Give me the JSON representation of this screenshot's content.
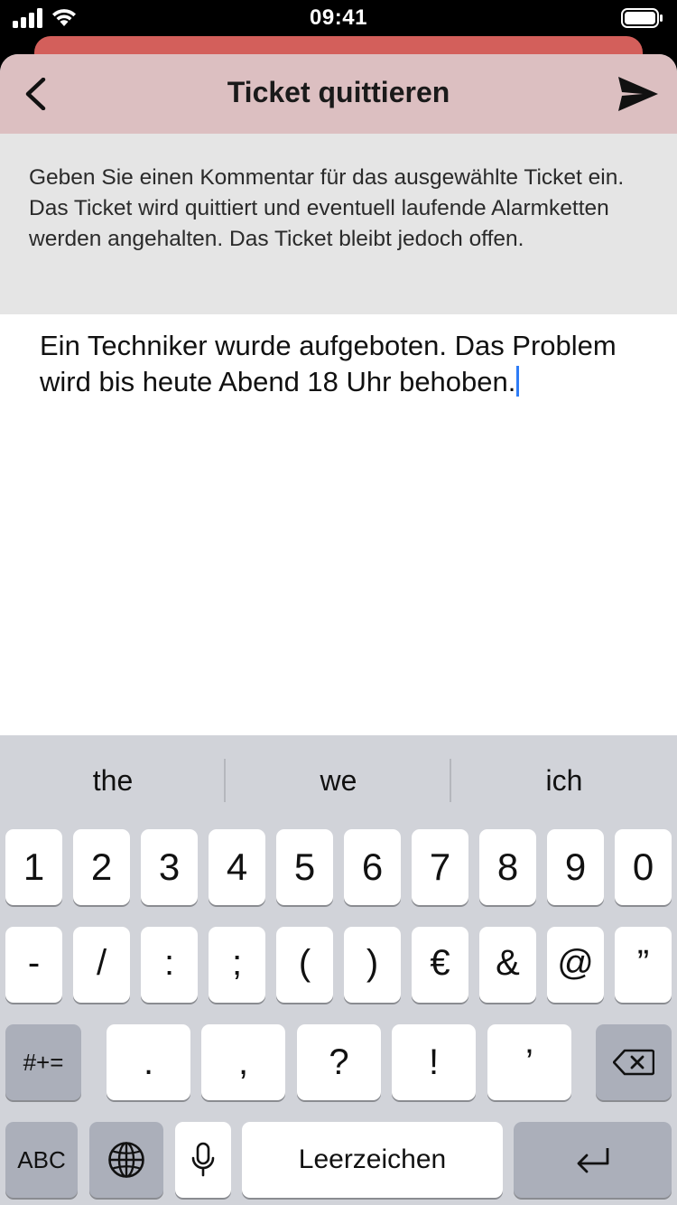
{
  "status": {
    "time": "09:41"
  },
  "nav": {
    "title": "Ticket quittieren",
    "back_icon": "chevron-left-icon",
    "send_icon": "paper-plane-icon"
  },
  "info": {
    "text": "Geben Sie einen Kommentar für das ausgewählte Ticket ein. Das Ticket wird quittiert und eventuell laufende Alarmketten werden angehalten. Das Ticket bleibt jedoch offen."
  },
  "comment": {
    "value": "Ein Techniker wurde aufgeboten. Das Problem wird bis heute Abend 18 Uhr behoben."
  },
  "keyboard": {
    "suggestions": [
      "the",
      "we",
      "ich"
    ],
    "row1": [
      "1",
      "2",
      "3",
      "4",
      "5",
      "6",
      "7",
      "8",
      "9",
      "0"
    ],
    "row2": [
      "-",
      "/",
      ":",
      ";",
      "(",
      ")",
      "€",
      "&",
      "@",
      "”"
    ],
    "row3": {
      "mode": "#+=",
      "keys": [
        ".",
        ",",
        "?",
        "!",
        "’"
      ],
      "delete_icon": "backspace-icon"
    },
    "row4": {
      "abc": "ABC",
      "globe_icon": "globe-icon",
      "mic_icon": "microphone-icon",
      "space": "Leerzeichen",
      "return_icon": "return-icon"
    }
  },
  "colors": {
    "nav_bg": "#dcbfc1",
    "back_sheet": "#d35f5b",
    "info_bg": "#e5e5e5",
    "keyboard_bg": "#d1d3d9",
    "cursor": "#2e7cf6"
  }
}
